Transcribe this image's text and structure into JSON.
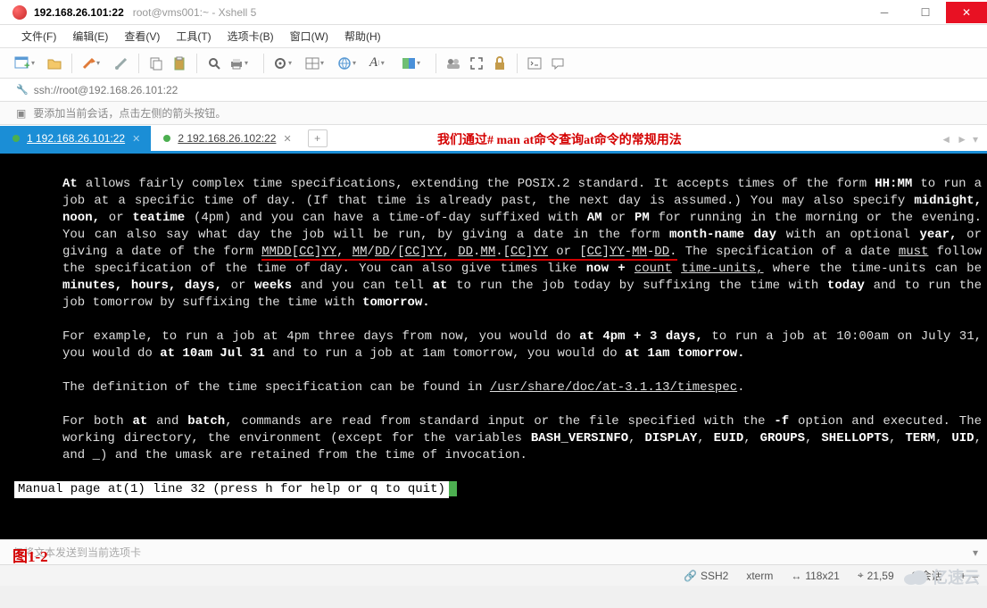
{
  "window": {
    "title_ip": "192.168.26.101:22",
    "title_sub": "root@vms001:~ - Xshell 5"
  },
  "menu": {
    "file": "文件(F)",
    "edit": "编辑(E)",
    "view": "查看(V)",
    "tools": "工具(T)",
    "tabs": "选项卡(B)",
    "window": "窗口(W)",
    "help": "帮助(H)"
  },
  "toolbar_icons": [
    "new-session",
    "open",
    "pencil",
    "copy",
    "paste",
    "search",
    "printer",
    "properties",
    "layout",
    "font",
    "color-a",
    "color-b",
    "users",
    "fullscreen",
    "lock",
    "exec",
    "help-bubble"
  ],
  "address": {
    "scheme_icon": "🔒",
    "url": "ssh://root@192.168.26.101:22"
  },
  "hint": {
    "icon": "▣",
    "text": "要添加当前会话，点击左侧的箭头按钮。"
  },
  "tabs": [
    {
      "label": "1 192.168.26.101:22",
      "active": true
    },
    {
      "label": "2 192.168.26.102:22",
      "active": false
    }
  ],
  "annotation_red": "我们通过# man at命令查询at命令的常规用法",
  "terminal": {
    "status_line": "Manual page at(1) line 32 (press h for help or q to quit)"
  },
  "send_placeholder": "仅将文本发送到当前选项卡",
  "figure_label": "图1-2",
  "statusbar": {
    "proto": "SSH2",
    "term": "xterm",
    "size": "118x21",
    "cursor": "21,59",
    "sessions": "2 会话"
  },
  "watermark_text": "亿速云"
}
